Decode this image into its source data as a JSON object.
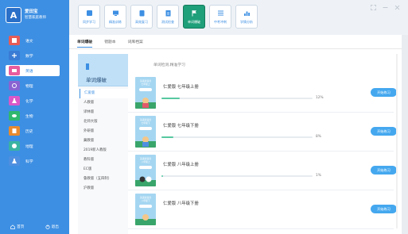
{
  "brand": {
    "logo_text": "A",
    "name_line1": "爱田宝",
    "name_line2": "智慧家庭教师"
  },
  "subjects": [
    {
      "label": "语文",
      "icon": "book-icon",
      "color": "#e85c56"
    },
    {
      "label": "数学",
      "icon": "calculator-icon",
      "color": "#3a7bd5"
    },
    {
      "label": "英语",
      "icon": "abc-icon",
      "color": "#e85c9e",
      "active": true
    },
    {
      "label": "物理",
      "icon": "atom-icon",
      "color": "#8a63d2"
    },
    {
      "label": "化学",
      "icon": "flask-icon",
      "color": "#d958c8"
    },
    {
      "label": "生物",
      "icon": "leaf-icon",
      "color": "#2fb86e"
    },
    {
      "label": "历史",
      "icon": "scroll-icon",
      "color": "#e88a2e"
    },
    {
      "label": "地理",
      "icon": "globe-icon",
      "color": "#39b3a2"
    },
    {
      "label": "科学",
      "icon": "flask-science-icon",
      "color": "#4f8fe0"
    }
  ],
  "sidebar_bottom": {
    "home": "首页",
    "logout": "退出"
  },
  "toolbar": [
    {
      "label": "同步学习",
      "icon": "book-open-icon"
    },
    {
      "label": "精准训练",
      "icon": "monitor-icon"
    },
    {
      "label": "高效复习",
      "icon": "clipboard-icon"
    },
    {
      "label": "测试检查",
      "icon": "test-paper-icon"
    },
    {
      "label": "单词爆破",
      "icon": "flag-icon",
      "active": true
    },
    {
      "label": "中考冲刺",
      "icon": "list-icon"
    },
    {
      "label": "学情分析",
      "icon": "bar-chart-icon"
    }
  ],
  "tabs": [
    {
      "label": "单词爆破",
      "active": true
    },
    {
      "label": "错题本"
    },
    {
      "label": "词库档案"
    }
  ],
  "left_panel": {
    "header": "单词爆破",
    "versions": [
      {
        "label": "仁爱版",
        "active": true
      },
      {
        "label": "人教版"
      },
      {
        "label": "译林版"
      },
      {
        "label": "北师大版"
      },
      {
        "label": "外研版"
      },
      {
        "label": "冀教版"
      },
      {
        "label": "2019新人教版"
      },
      {
        "label": "教科版"
      },
      {
        "label": "EC版"
      },
      {
        "label": "鲁教版（五四制）"
      },
      {
        "label": "沪教版"
      }
    ]
  },
  "main": {
    "subtitle": "单词检测,精准学习",
    "books": [
      {
        "cover_line1": "英语新语音",
        "cover_line2": "七年级上",
        "title": "仁爱版 七年级上册",
        "progress": 12,
        "progress_label": "12%",
        "button": "开始练习"
      },
      {
        "cover_line1": "英语新语音",
        "cover_line2": "七年级下",
        "title": "仁爱版 七年级下册",
        "progress": 8,
        "progress_label": "8%",
        "button": "开始练习"
      },
      {
        "cover_line1": "英语新语音",
        "cover_line2": "八年级上",
        "title": "仁爱版 八年级上册",
        "progress": 1,
        "progress_label": "1%",
        "button": "开始练习"
      },
      {
        "cover_line1": "英语新语音",
        "cover_line2": "八年级下",
        "title": "仁爱版 八年级下册",
        "progress": 0,
        "progress_label": "",
        "button": "开始练习"
      }
    ]
  },
  "colors": {
    "sidebar": "#3d8fe3",
    "accent": "#45a8ef",
    "active_tool": "#1f9f7a",
    "progress": "#57c8a0"
  }
}
